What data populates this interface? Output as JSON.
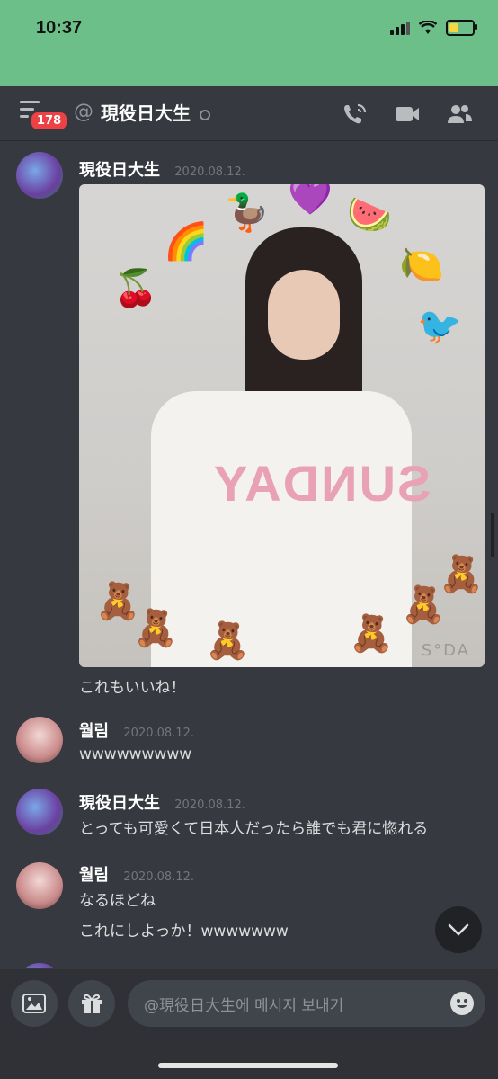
{
  "status_bar": {
    "time": "10:37"
  },
  "header": {
    "badge": "178",
    "at_symbol": "@",
    "title": "現役日大生"
  },
  "messages": [
    {
      "author": "現役日大生",
      "time": "2020.08.12.",
      "text": "これもいいね！",
      "attachment": {
        "watermark": "S°DA",
        "shirt_text": "SUNDAY"
      }
    },
    {
      "author": "월림",
      "time": "2020.08.12.",
      "text": "wwwwwwwww"
    },
    {
      "author": "現役日大生",
      "time": "2020.08.12.",
      "text": "とっても可愛くて日本人だったら誰でも君に惚れる"
    },
    {
      "author": "월림",
      "time": "2020.08.12.",
      "lines": [
        "なるほどね",
        "これにしよっか！wwwwwww"
      ]
    }
  ],
  "input": {
    "placeholder": "@現役日大生에 메시지 보내기"
  },
  "colors": {
    "status_bar": "#6dbf8a",
    "background": "#36393f",
    "badge": "#ed4245"
  }
}
